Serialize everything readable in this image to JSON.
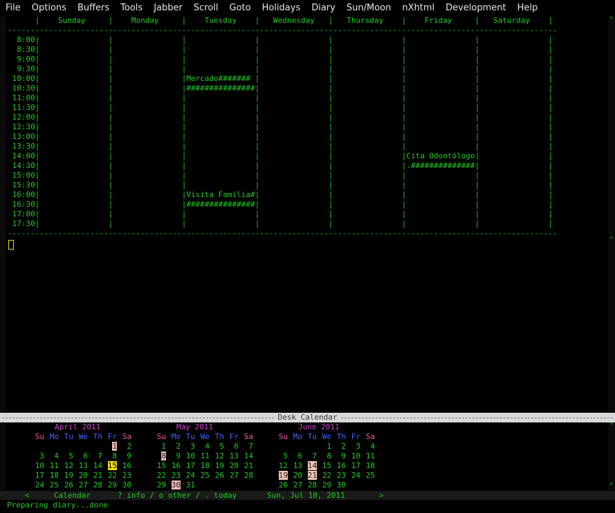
{
  "menubar": {
    "items": [
      "File",
      "Options",
      "Buffers",
      "Tools",
      "Jabber",
      "Scroll",
      "Goto",
      "Holidays",
      "Diary",
      "Sun/Moon",
      "nXhtml",
      "Development",
      "Help"
    ]
  },
  "week_view": {
    "header": [
      "Sunday",
      "Monday",
      "Tuesday",
      "Wednesday",
      "Thursday",
      "Friday",
      "Saturday"
    ],
    "times": [
      "8:00",
      "8:30",
      "9:00",
      "9:30",
      "10:00",
      "10:30",
      "11:00",
      "11:30",
      "12:00",
      "12:30",
      "13:00",
      "13:30",
      "14:00",
      "14:30",
      "15:00",
      "15:30",
      "16:00",
      "16:30",
      "17:00",
      "17:30"
    ],
    "events": [
      {
        "day": "Tuesday",
        "times": [
          "10:00",
          "10:30"
        ],
        "lines": [
          "Mercado#######",
          "###############"
        ]
      },
      {
        "day": "Friday",
        "times": [
          "14:00",
          "14:30"
        ],
        "lines": [
          "Cita Odontólogo",
          ".##############"
        ]
      },
      {
        "day": "Tuesday",
        "times": [
          "16:00",
          "16:30"
        ],
        "lines": [
          "Visita Familia#",
          "###############"
        ]
      }
    ]
  },
  "desk_calendar": {
    "title": "Desk Calendar",
    "day_headers": [
      "Su",
      "Mo",
      "Tu",
      "We",
      "Th",
      "Fr",
      "Sa"
    ],
    "months": [
      {
        "title": "April 2011",
        "weeks": [
          [
            "",
            "",
            "",
            "",
            "",
            "1",
            "2"
          ],
          [
            "3",
            "4",
            "5",
            "6",
            "7",
            "8",
            "9"
          ],
          [
            "10",
            "11",
            "12",
            "13",
            "14",
            "15",
            "16"
          ],
          [
            "17",
            "18",
            "19",
            "20",
            "21",
            "22",
            "23"
          ],
          [
            "24",
            "25",
            "26",
            "27",
            "28",
            "29",
            "30"
          ]
        ]
      },
      {
        "title": "May 2011",
        "weeks": [
          [
            "1",
            "2",
            "3",
            "4",
            "5",
            "6",
            "7"
          ],
          [
            "8",
            "9",
            "10",
            "11",
            "12",
            "13",
            "14"
          ],
          [
            "15",
            "16",
            "17",
            "18",
            "19",
            "20",
            "21"
          ],
          [
            "22",
            "23",
            "24",
            "25",
            "26",
            "27",
            "28"
          ],
          [
            "29",
            "30",
            "31",
            "",
            "",
            "",
            ""
          ]
        ]
      },
      {
        "title": "June 2011",
        "weeks": [
          [
            "",
            "",
            "",
            "1",
            "2",
            "3",
            "4"
          ],
          [
            "5",
            "6",
            "7",
            "8",
            "9",
            "10",
            "11"
          ],
          [
            "12",
            "13",
            "14",
            "15",
            "16",
            "17",
            "18"
          ],
          [
            "19",
            "20",
            "21",
            "22",
            "23",
            "24",
            "25"
          ],
          [
            "26",
            "27",
            "28",
            "29",
            "30",
            "",
            ""
          ]
        ]
      }
    ]
  },
  "mode_line": {
    "left_arrow": "<",
    "mode": "Calendar",
    "help": "? info / o other / . today",
    "date": "Sun, Jul 10, 2011",
    "right_arrow": ">"
  },
  "minibuffer": {
    "message": "Preparing diary...done"
  }
}
